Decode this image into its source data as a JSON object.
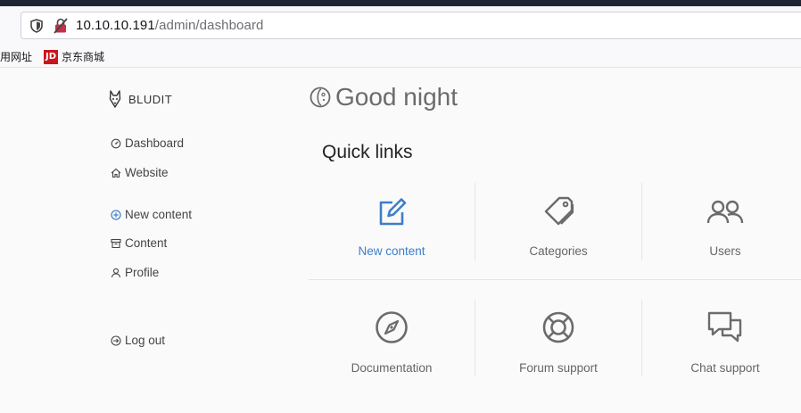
{
  "browser": {
    "url_host": "10.10.10.191",
    "url_path": "/admin/dashboard",
    "bookmarks": [
      {
        "label": "用网址"
      },
      {
        "label": "京东商城",
        "icon_text": "JD"
      }
    ]
  },
  "sidebar": {
    "brand": "BLUDIT",
    "items": [
      {
        "label": "Dashboard",
        "icon": "dashboard-icon"
      },
      {
        "label": "Website",
        "icon": "home-icon"
      },
      {
        "label": "New content",
        "icon": "plus-circle-icon"
      },
      {
        "label": "Content",
        "icon": "archive-icon"
      },
      {
        "label": "Profile",
        "icon": "person-icon"
      },
      {
        "label": "Log out",
        "icon": "logout-icon"
      }
    ]
  },
  "main": {
    "greeting": "Good night",
    "quick_links_title": "Quick links",
    "tiles": [
      {
        "label": "New content",
        "icon": "edit-icon"
      },
      {
        "label": "Categories",
        "icon": "tags-icon"
      },
      {
        "label": "Users",
        "icon": "users-icon"
      },
      {
        "label": "Documentation",
        "icon": "compass-icon"
      },
      {
        "label": "Forum support",
        "icon": "lifebuoy-icon"
      },
      {
        "label": "Chat support",
        "icon": "chat-icon"
      }
    ]
  },
  "colors": {
    "accent": "#3d7ecb",
    "icon_gray": "#6b6b6b",
    "page_bg": "#fafafa"
  }
}
